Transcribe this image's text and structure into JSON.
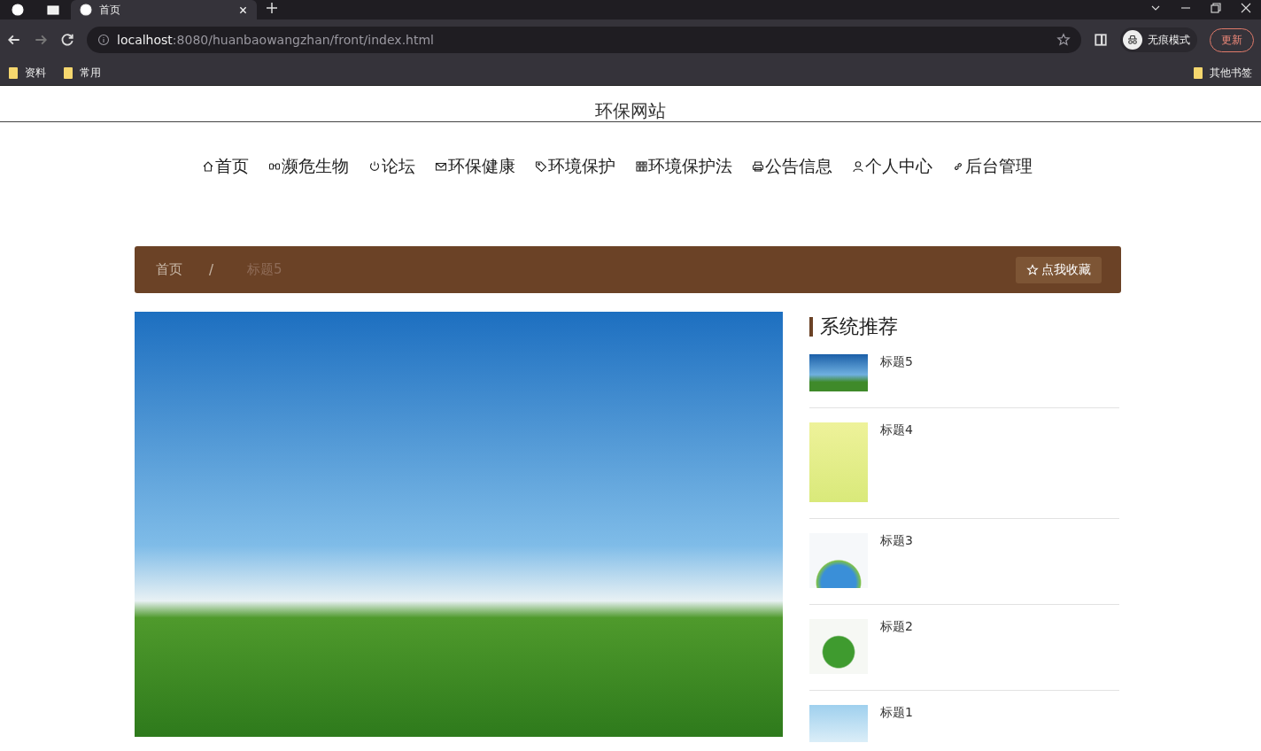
{
  "browser": {
    "tabs": [
      {
        "title": "首页"
      }
    ],
    "address": {
      "host": "localhost",
      "path": ":8080/huanbaowangzhan/front/index.html"
    },
    "profile_label": "无痕模式",
    "update_button": "更新",
    "bookmarks": [
      {
        "label": "资料"
      },
      {
        "label": "常用"
      }
    ],
    "other_bookmarks": "其他书签"
  },
  "site_title": "环保网站",
  "nav": [
    {
      "label": "首页"
    },
    {
      "label": "濒危生物"
    },
    {
      "label": "论坛"
    },
    {
      "label": "环保健康"
    },
    {
      "label": "环境保护"
    },
    {
      "label": "环境保护法"
    },
    {
      "label": "公告信息"
    },
    {
      "label": "个人中心"
    },
    {
      "label": "后台管理"
    }
  ],
  "breadcrumb": {
    "separator": "/",
    "items": [
      {
        "label": "首页",
        "current": false
      },
      {
        "label": "标题5",
        "current": true
      }
    ]
  },
  "favorite_button": "点我收藏",
  "sidebar": {
    "title": "系统推荐",
    "items": [
      {
        "title": "标题5"
      },
      {
        "title": "标题4"
      },
      {
        "title": "标题3"
      },
      {
        "title": "标题2"
      },
      {
        "title": "标题1"
      }
    ]
  }
}
